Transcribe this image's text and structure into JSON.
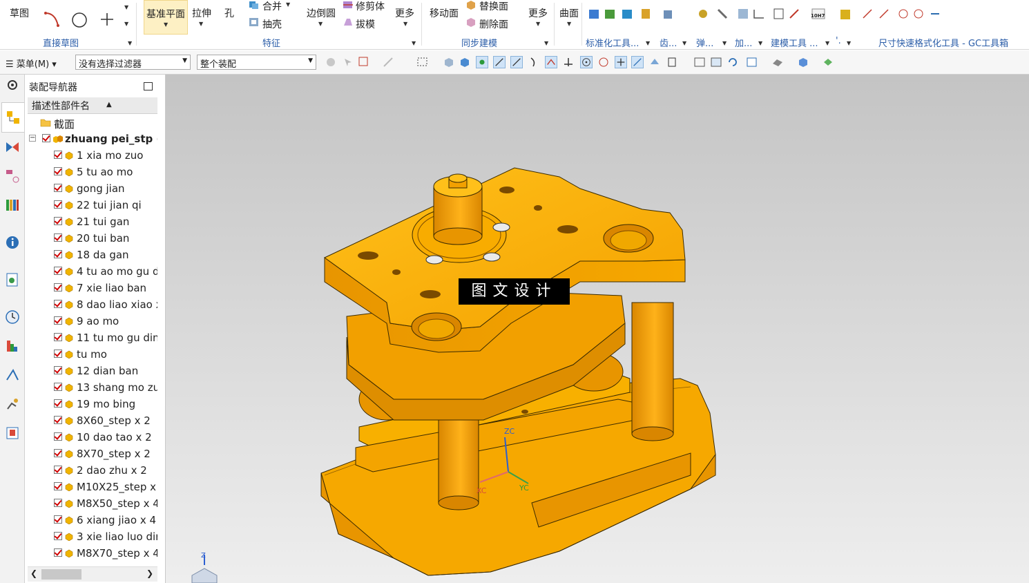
{
  "ribbon": {
    "sketch_label": "草图",
    "direct_sketch_group": "直接草图",
    "datum_plane_label": "基准平面",
    "extrude_label": "拉伸",
    "hole_label": "孔",
    "unite_label": "合并",
    "shell_label": "抽壳",
    "edge_blend_label": "边倒圆",
    "trim_body_label": "修剪体",
    "draft_label": "拔模",
    "more1_label": "更多",
    "feature_group": "特征",
    "move_face_label": "移动面",
    "replace_face_label": "替换面",
    "delete_face_label": "删除面",
    "more2_label": "更多",
    "sync_group": "同步建模",
    "surface_label": "曲面",
    "std_tools_group": "标准化工具...",
    "gear_group": "齿...",
    "spring_group": "弹...",
    "machining_group": "加...",
    "modeling_tools_group": "建模工具 ...",
    "dot_group": "'.",
    "gc_group": "尺寸快速格式化工具 - GC工具箱",
    "gc_badge": "10H7"
  },
  "toolbar": {
    "menu_label": "菜单(M)",
    "filter_value": "没有选择过滤器",
    "scope_value": "整个装配"
  },
  "navigator": {
    "title": "装配导航器",
    "column_header": "描述性部件名",
    "section_label": "截面",
    "root_label": "zhuang pei_stp  (l",
    "parts": [
      "1 xia mo zuo",
      "5 tu ao mo",
      "gong jian",
      "22 tui jian qi",
      "21 tui gan",
      "20 tui ban",
      "18 da gan",
      "4 tu ao mo gu d",
      "7 xie liao ban",
      "8 dao liao xiao x",
      "9 ao mo",
      "11 tu mo gu din",
      "tu mo",
      "12 dian ban",
      "13 shang mo zu",
      "19 mo bing",
      "8X60_step x 2",
      "10 dao tao x 2",
      "8X70_step x 2",
      "2 dao zhu x 2",
      "M10X25_step x",
      "M8X50_step x 4",
      "6 xiang jiao x 4",
      "3 xie liao luo dir",
      "M8X70_step x 4"
    ]
  },
  "viewport": {
    "watermark": "图文设计",
    "axis_zc": "ZC",
    "axis_xc": "XC",
    "axis_yc": "YC",
    "triad_z": "Z"
  },
  "colors": {
    "part": "#f6a800",
    "part_light": "#fcc200",
    "part_dark": "#d98600",
    "accent": "#2b5da8"
  }
}
